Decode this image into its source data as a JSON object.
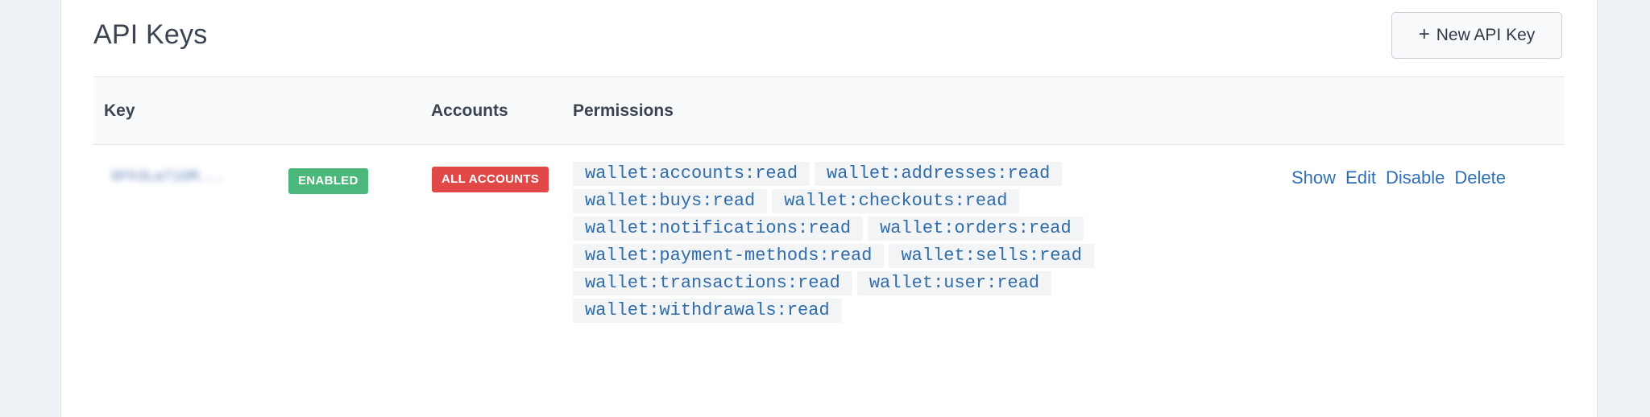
{
  "section": {
    "title": "API Keys",
    "new_key_label": "New API Key",
    "new_key_icon": "+"
  },
  "table": {
    "headers": {
      "key": "Key",
      "accounts": "Accounts",
      "permissions": "Permissions"
    },
    "rows": [
      {
        "key": "6Fh3La7iGM...",
        "status": "ENABLED",
        "accounts": "ALL ACCOUNTS",
        "permission_lines": [
          [
            "wallet:accounts:read",
            "wallet:addresses:read"
          ],
          [
            "wallet:buys:read",
            "wallet:checkouts:read"
          ],
          [
            "wallet:notifications:read",
            "wallet:orders:read"
          ],
          [
            "wallet:payment-methods:read",
            "wallet:sells:read"
          ],
          [
            "wallet:transactions:read",
            "wallet:user:read"
          ],
          [
            "wallet:withdrawals:read"
          ]
        ],
        "actions": {
          "show": "Show",
          "edit": "Edit",
          "disable": "Disable",
          "delete": "Delete"
        }
      }
    ]
  },
  "colors": {
    "enabled_badge": "#4bb77a",
    "accounts_badge": "#e04948",
    "link": "#2e6fb5",
    "permission_text": "#2f6ca8"
  }
}
